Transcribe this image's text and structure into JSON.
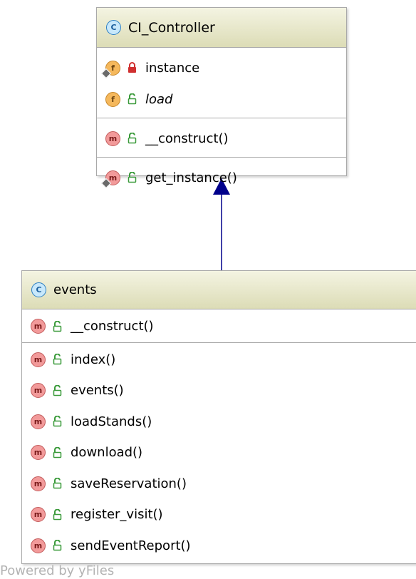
{
  "parent_class": {
    "name": "CI_Controller",
    "badge": "C",
    "fields": [
      {
        "badge": "f",
        "name": "instance",
        "visibility": "private",
        "overridden": true
      },
      {
        "badge": "f",
        "name": "load",
        "visibility": "public",
        "italic": true
      }
    ],
    "constructors": [
      {
        "badge": "m",
        "name": "__construct()",
        "visibility": "public"
      }
    ],
    "methods": [
      {
        "badge": "m",
        "name": "get_instance()",
        "visibility": "public",
        "overridden": true
      }
    ]
  },
  "child_class": {
    "name": "events",
    "badge": "C",
    "constructors": [
      {
        "badge": "m",
        "name": "__construct()",
        "visibility": "public"
      }
    ],
    "methods": [
      {
        "badge": "m",
        "name": "index()",
        "visibility": "public"
      },
      {
        "badge": "m",
        "name": "events()",
        "visibility": "public"
      },
      {
        "badge": "m",
        "name": "loadStands()",
        "visibility": "public"
      },
      {
        "badge": "m",
        "name": "download()",
        "visibility": "public"
      },
      {
        "badge": "m",
        "name": "saveReservation()",
        "visibility": "public"
      },
      {
        "badge": "m",
        "name": "register_visit()",
        "visibility": "public"
      },
      {
        "badge": "m",
        "name": "sendEventReport()",
        "visibility": "public"
      }
    ]
  },
  "footer": {
    "text": "Powered by yFiles"
  },
  "colors": {
    "edge": "#00008b",
    "public_lock": "#3a9a3a",
    "private_lock": "#d03030",
    "header": "#e8e8c8"
  }
}
